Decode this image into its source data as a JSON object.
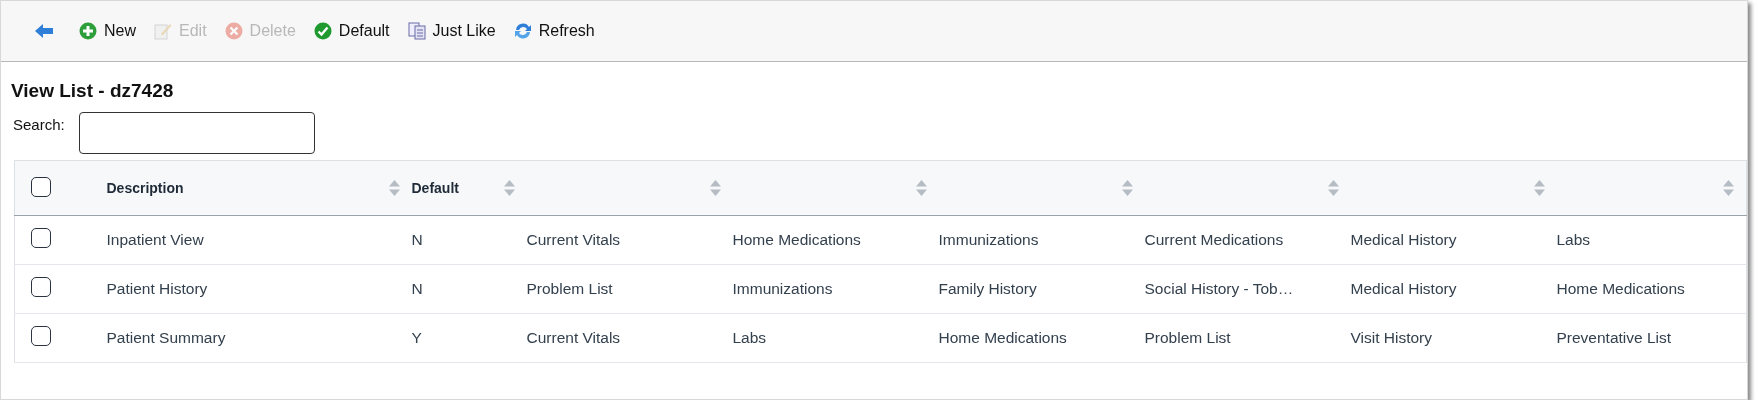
{
  "toolbar": [
    {
      "kind": "back"
    },
    {
      "kind": "new",
      "label": "New",
      "disabled": false
    },
    {
      "kind": "edit",
      "label": "Edit",
      "disabled": true
    },
    {
      "kind": "delete",
      "label": "Delete",
      "disabled": true
    },
    {
      "kind": "default",
      "label": "Default",
      "disabled": false
    },
    {
      "kind": "copy",
      "label": "Just Like",
      "disabled": false
    },
    {
      "kind": "refresh",
      "label": "Refresh",
      "disabled": false
    }
  ],
  "title": "View List - dz7428",
  "search": {
    "label": "Search:"
  },
  "table": {
    "all_checked": false,
    "columns": [
      {
        "label": "Description",
        "sortable": true
      },
      {
        "label": "Default",
        "sortable": true
      },
      {
        "sortable": true
      },
      {
        "sortable": true
      },
      {
        "sortable": true
      },
      {
        "sortable": true
      },
      {
        "sortable": true
      },
      {
        "sortable": true
      }
    ],
    "rows": [
      {
        "checked": false,
        "cells": [
          "Inpatient View",
          "N",
          "Current Vitals",
          "Home Medications",
          "Immunizations",
          "Current Medications",
          "Medical History",
          "Labs"
        ]
      },
      {
        "checked": false,
        "cells": [
          "Patient History",
          "N",
          "Problem List",
          "Immunizations",
          "Family History",
          "Social History - Tob…",
          "Medical History",
          "Home Medications"
        ]
      },
      {
        "checked": false,
        "cells": [
          "Patient Summary",
          "Y",
          "Current Vitals",
          "Labs",
          "Home Medications",
          "Problem List",
          "Visit History",
          "Preventative List"
        ]
      }
    ]
  }
}
